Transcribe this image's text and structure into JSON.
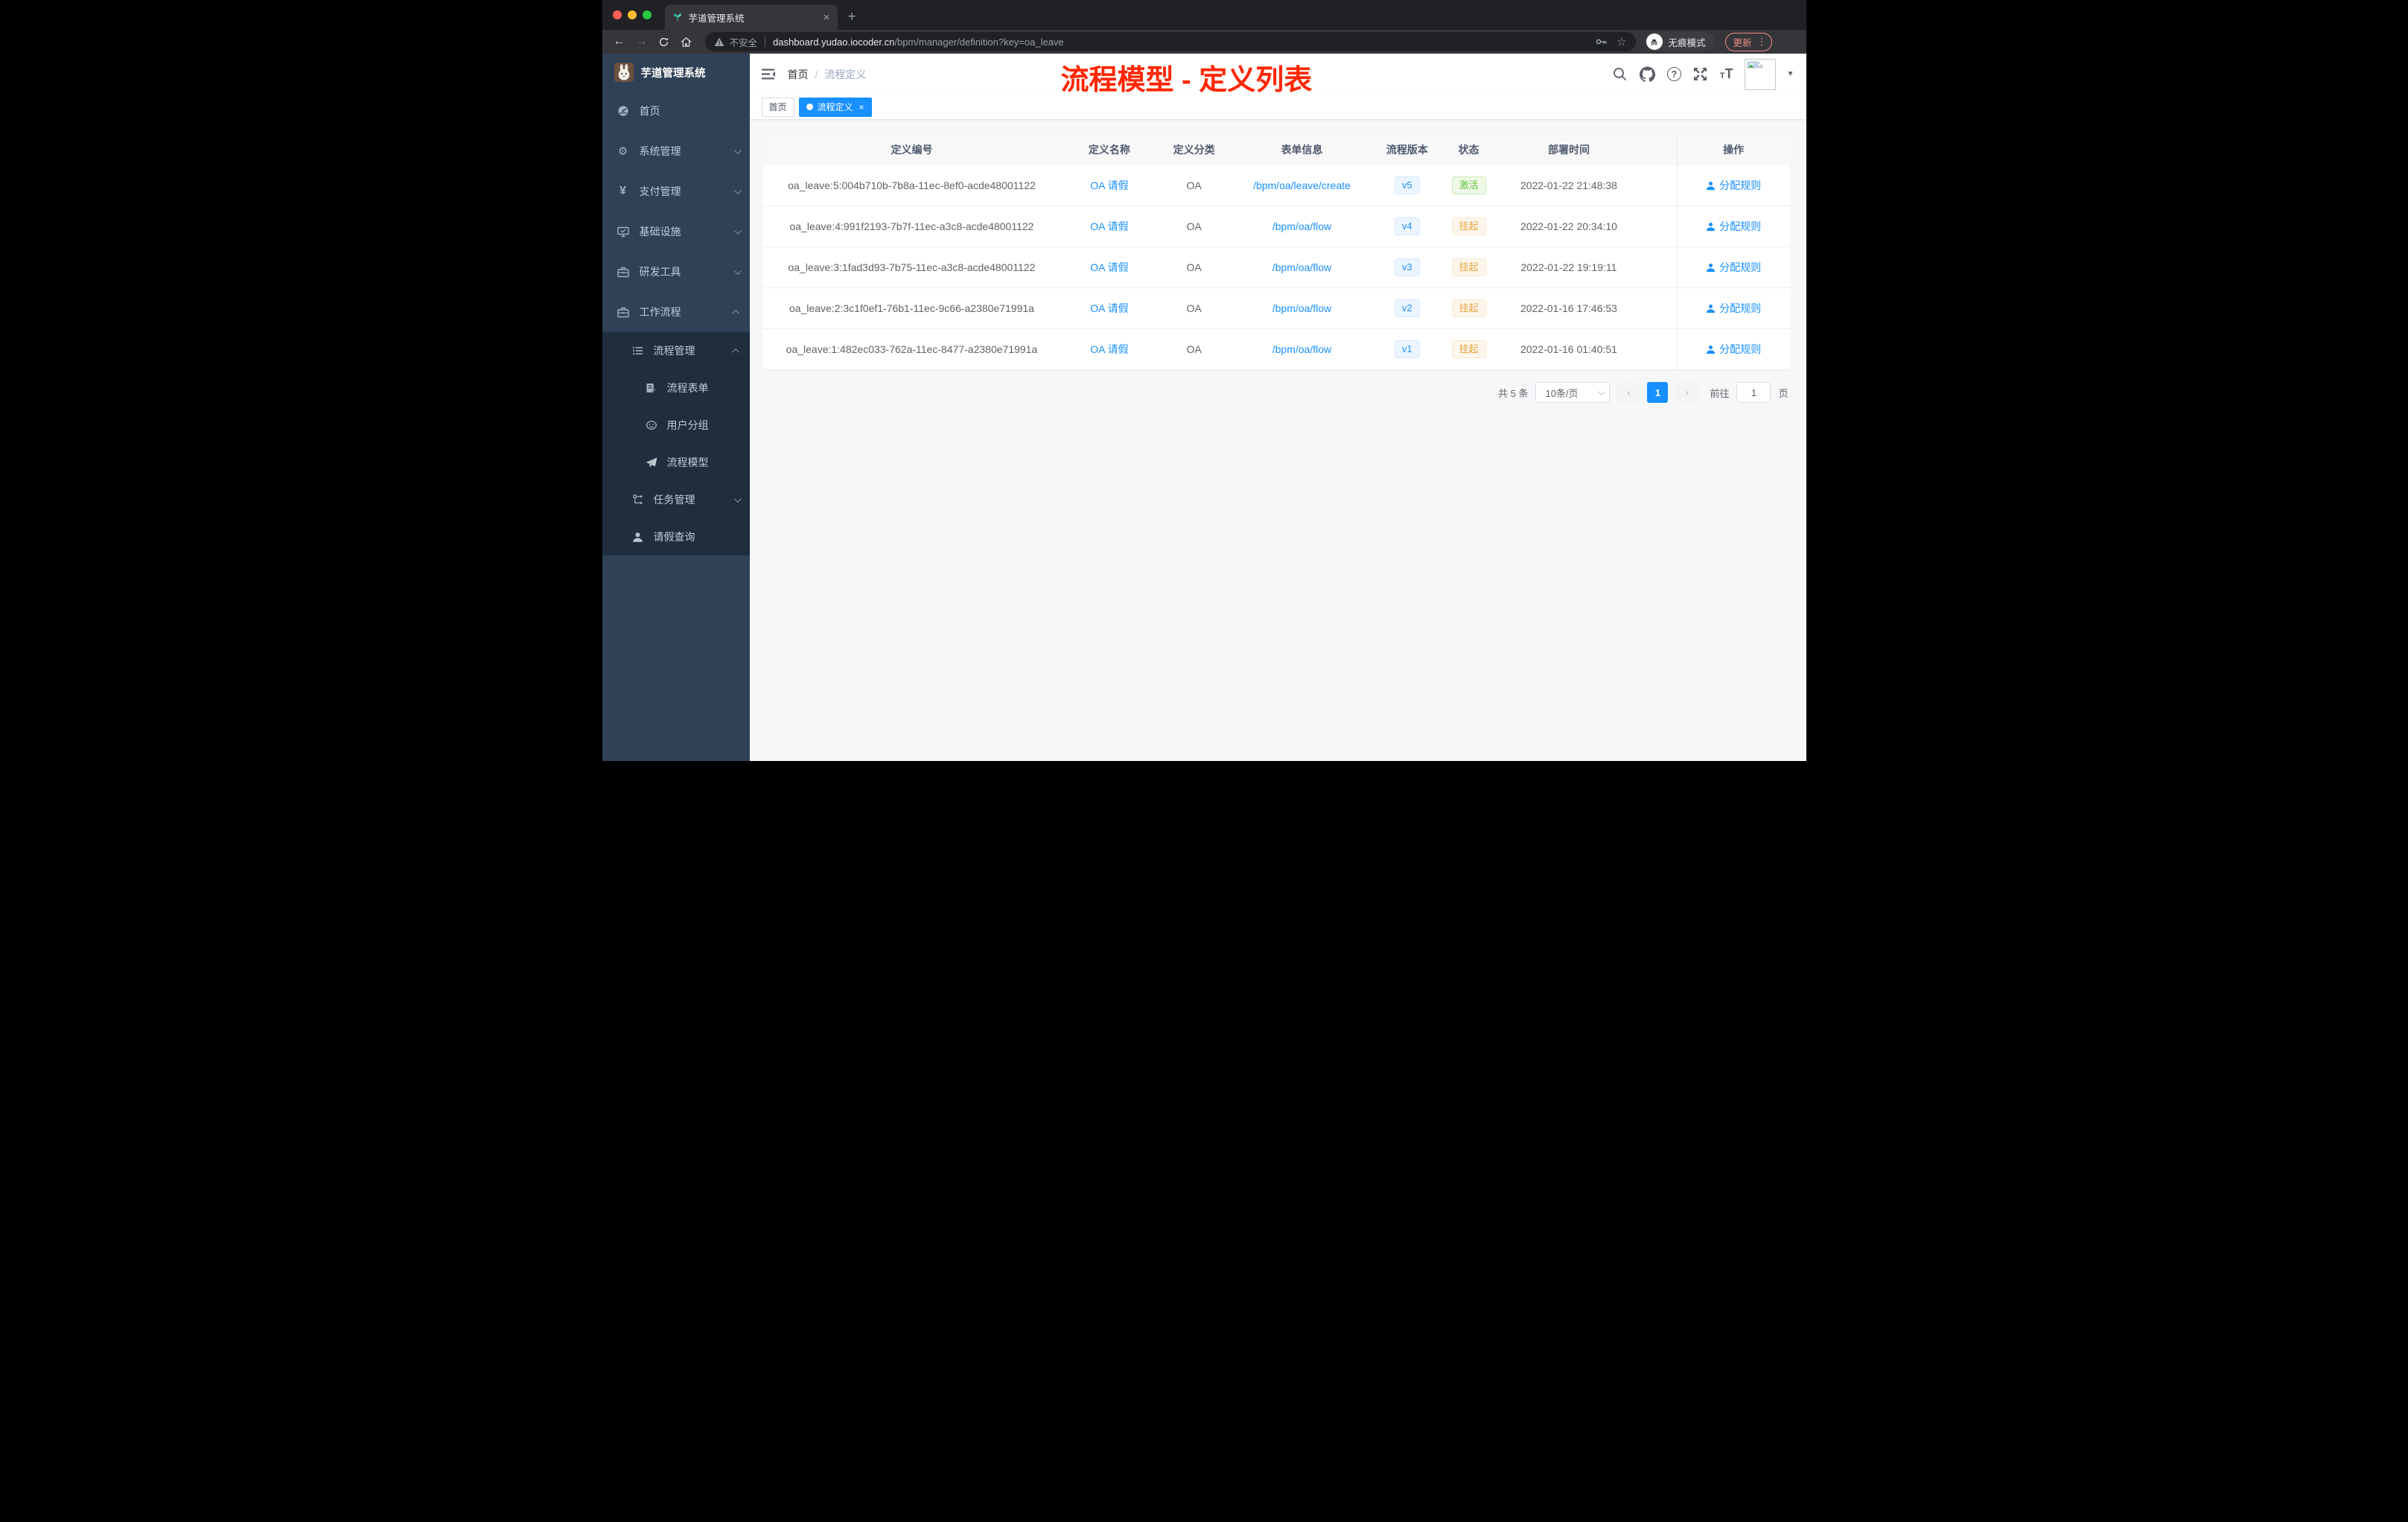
{
  "colors": {
    "accent": "#1890ff",
    "danger": "#ff2600",
    "success": "#67c23a",
    "warning": "#e6a23c",
    "sidebar-bg": "#304156",
    "submenu-bg": "#1f2d3d"
  },
  "browser": {
    "tab_title": "芋道管理系统",
    "security_label": "不安全",
    "url_host": "dashboard.yudao.iocoder.cn",
    "url_path": "/bpm/manager/definition?key=oa_leave",
    "incognito_label": "无痕模式",
    "update_label": "更新"
  },
  "icons": {
    "close_tab": "×",
    "new_tab": "+",
    "back": "←",
    "forward": "→",
    "star": "☆",
    "dots": "⋮",
    "question": "?",
    "caret_down": "▼",
    "breadcrumb_sep": "/",
    "tag_close": "×",
    "prev": "‹",
    "next": "›",
    "gear": "⚙",
    "yen": "¥",
    "font_small": "T",
    "font_large": "T"
  },
  "sidebar": {
    "logo_title": "芋道管理系统",
    "items": [
      {
        "label": "首页"
      },
      {
        "label": "系统管理",
        "state": "collapsed"
      },
      {
        "label": "支付管理",
        "state": "collapsed"
      },
      {
        "label": "基础设施",
        "state": "collapsed"
      },
      {
        "label": "研发工具",
        "state": "collapsed"
      },
      {
        "label": "工作流程",
        "state": "expanded"
      }
    ],
    "submenu": [
      {
        "label": "流程管理",
        "state": "expanded"
      },
      {
        "label": "流程表单"
      },
      {
        "label": "用户分组"
      },
      {
        "label": "流程模型"
      },
      {
        "label": "任务管理",
        "state": "collapsed"
      },
      {
        "label": "请假查询"
      }
    ]
  },
  "header": {
    "breadcrumb": [
      "首页",
      "流程定义"
    ],
    "annotation": "流程模型 - 定义列表"
  },
  "tags": [
    {
      "label": "首页",
      "active": false
    },
    {
      "label": "流程定义",
      "active": true,
      "closable": true
    }
  ],
  "table": {
    "columns": [
      "定义编号",
      "定义名称",
      "定义分类",
      "表单信息",
      "流程版本",
      "状态",
      "部署时间",
      "操作"
    ],
    "rows": [
      {
        "id": "oa_leave:5:004b710b-7b8a-11ec-8ef0-acde48001122",
        "name": "OA 请假",
        "category": "OA",
        "form": "/bpm/oa/leave/create",
        "version": "v5",
        "status": "激活",
        "status_type": "success",
        "deployed": "2022-01-22 21:48:38",
        "action": "分配规则"
      },
      {
        "id": "oa_leave:4:991f2193-7b7f-11ec-a3c8-acde48001122",
        "name": "OA 请假",
        "category": "OA",
        "form": "/bpm/oa/flow",
        "version": "v4",
        "status": "挂起",
        "status_type": "warning",
        "deployed": "2022-01-22 20:34:10",
        "action": "分配规则"
      },
      {
        "id": "oa_leave:3:1fad3d93-7b75-11ec-a3c8-acde48001122",
        "name": "OA 请假",
        "category": "OA",
        "form": "/bpm/oa/flow",
        "version": "v3",
        "status": "挂起",
        "status_type": "warning",
        "deployed": "2022-01-22 19:19:11",
        "action": "分配规则"
      },
      {
        "id": "oa_leave:2:3c1f0ef1-76b1-11ec-9c66-a2380e71991a",
        "name": "OA 请假",
        "category": "OA",
        "form": "/bpm/oa/flow",
        "version": "v2",
        "status": "挂起",
        "status_type": "warning",
        "deployed": "2022-01-16 17:46:53",
        "action": "分配规则"
      },
      {
        "id": "oa_leave:1:482ec033-762a-11ec-8477-a2380e71991a",
        "name": "OA 请假",
        "category": "OA",
        "form": "/bpm/oa/flow",
        "version": "v1",
        "status": "挂起",
        "status_type": "warning",
        "deployed": "2022-01-16 01:40:51",
        "action": "分配规则"
      }
    ]
  },
  "pagination": {
    "total_label": "共 5 条",
    "page_size": "10条/页",
    "current_page": "1",
    "goto_label": "前往",
    "goto_value": "1",
    "page_unit": "页"
  }
}
